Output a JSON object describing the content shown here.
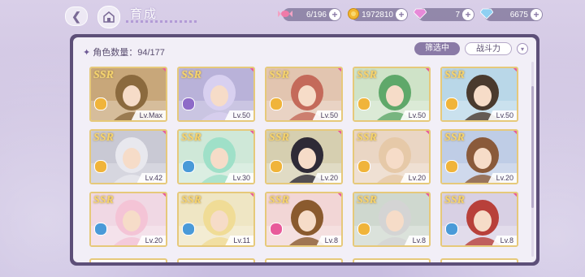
{
  "header": {
    "title": "育成",
    "resources": [
      {
        "name": "candy-icon",
        "value": "6/196"
      },
      {
        "name": "coin-icon",
        "value": "1972810"
      },
      {
        "name": "pink-gem-icon",
        "value": "7"
      },
      {
        "name": "blue-gem-icon",
        "value": "6675"
      }
    ]
  },
  "panel": {
    "count_label": "角色数量：94/177",
    "filter_label": "筛选中",
    "sort_label": "战斗力"
  },
  "cards": [
    {
      "rarity": "SSR",
      "level": "Lv.Max",
      "bg": "#c8a77a",
      "hair": "#8b6a3e",
      "elem": "#f0b43a"
    },
    {
      "rarity": "SSR",
      "level": "Lv.50",
      "bg": "#b9b2d9",
      "hair": "#d8d0f0",
      "elem": "#8e6ac8"
    },
    {
      "rarity": "SSR",
      "level": "Lv.50",
      "bg": "#e2c5b0",
      "hair": "#c46a5a",
      "elem": "#f0b43a"
    },
    {
      "rarity": "SSR",
      "level": "Lv.50",
      "bg": "#cfe3c8",
      "hair": "#5fa86a",
      "elem": "#f0b43a"
    },
    {
      "rarity": "SSR",
      "level": "Lv.50",
      "bg": "#b9d7e8",
      "hair": "#4a3a2e",
      "elem": "#f0b43a"
    },
    {
      "rarity": "SSR",
      "level": "Lv.42",
      "bg": "#c9c9d4",
      "hair": "#e8e8ee",
      "elem": "#f0b43a"
    },
    {
      "rarity": "SSR",
      "level": "Lv.30",
      "bg": "#cfe8d8",
      "hair": "#9fe0c8",
      "elem": "#4a9ad8"
    },
    {
      "rarity": "SSR",
      "level": "Lv.20",
      "bg": "#d6cfb0",
      "hair": "#2e2a36",
      "elem": "#f0b43a"
    },
    {
      "rarity": "SSR",
      "level": "Lv.20",
      "bg": "#ead6c4",
      "hair": "#e6c9a8",
      "elem": "#f0b43a"
    },
    {
      "rarity": "SSR",
      "level": "Lv.20",
      "bg": "#bfcde6",
      "hair": "#8a5a3a",
      "elem": "#f0b43a"
    },
    {
      "rarity": "SSR",
      "level": "Lv.20",
      "bg": "#f0d8e4",
      "hair": "#f4c4d6",
      "elem": "#4a9ad8"
    },
    {
      "rarity": "SSR",
      "level": "Lv.11",
      "bg": "#efe6c4",
      "hair": "#f0dc96",
      "elem": "#4a9ad8"
    },
    {
      "rarity": "SSR",
      "level": "Lv.8",
      "bg": "#f2d6d6",
      "hair": "#8a5a2e",
      "elem": "#e85a9a"
    },
    {
      "rarity": "SSR",
      "level": "Lv.8",
      "bg": "#cfd8cf",
      "hair": "#d4d4d4",
      "elem": "#f0b43a"
    },
    {
      "rarity": "SSR",
      "level": "Lv.8",
      "bg": "#d8d0e4",
      "hair": "#b8403a",
      "elem": "#4a9ad8"
    }
  ]
}
